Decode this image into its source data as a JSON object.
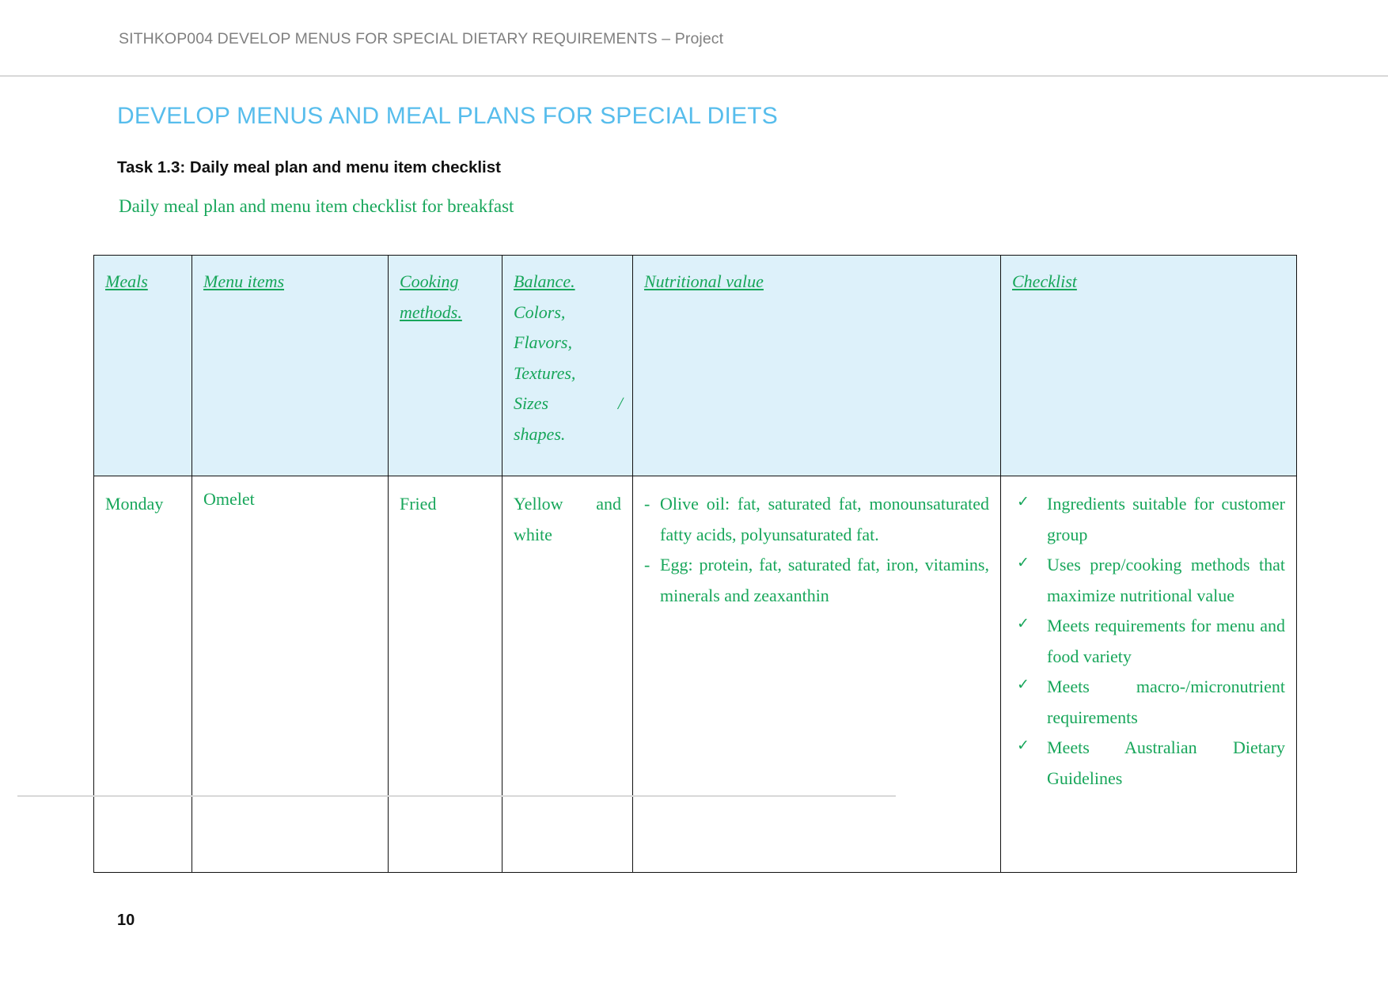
{
  "header": {
    "running_title": "SITHKOP004 DEVELOP MENUS FOR SPECIAL DIETARY REQUIREMENTS – Project"
  },
  "document": {
    "main_title": "DEVELOP MENUS AND MEAL PLANS FOR SPECIAL DIETS",
    "task_heading": "Task 1.3: Daily meal plan and menu item checklist",
    "subtitle": "Daily meal plan and menu item checklist for breakfast",
    "title_color": "#57bdec",
    "body_text_color": "#17a65a",
    "header_fill_color": "#ddf1fa"
  },
  "table": {
    "headers": {
      "meals": "Meals",
      "menu_items": "Menu items",
      "cooking_methods_line1": "Cooking",
      "cooking_methods_line2": "methods.",
      "balance_title": "Balance.",
      "balance_colors": "Colors,",
      "balance_flavors": "Flavors,",
      "balance_textures": "Textures,",
      "balance_sizes": "Sizes",
      "balance_slash": "/",
      "balance_shapes": "shapes.",
      "nutritional_value": "Nutritional value",
      "checklist": "Checklist"
    },
    "rows": [
      {
        "meal": "Monday",
        "menu_item": "Omelet",
        "cooking_method": "Fried",
        "balance": "Yellow and white",
        "nutritional_value": [
          {
            "marker": "-",
            "text": "Olive oil: fat, saturated fat, monounsaturated fatty acids, polyunsaturated fat."
          },
          {
            "marker": "-",
            "text": "Egg: protein, fat, saturated fat, iron, vitamins, minerals and zeaxanthin"
          }
        ],
        "checklist": [
          {
            "marker": "✓",
            "text": "Ingredients suitable for customer group"
          },
          {
            "marker": "✓",
            "text": "Uses prep/cooking methods that maximize nutritional value"
          },
          {
            "marker": "✓",
            "text": "Meets requirements for menu and food variety"
          },
          {
            "marker": "✓",
            "text": "Meets macro-/micronutrient requirements"
          },
          {
            "marker": "✓",
            "text": "Meets Australian Dietary Guidelines"
          }
        ]
      }
    ]
  },
  "footer": {
    "page_number": "10"
  }
}
